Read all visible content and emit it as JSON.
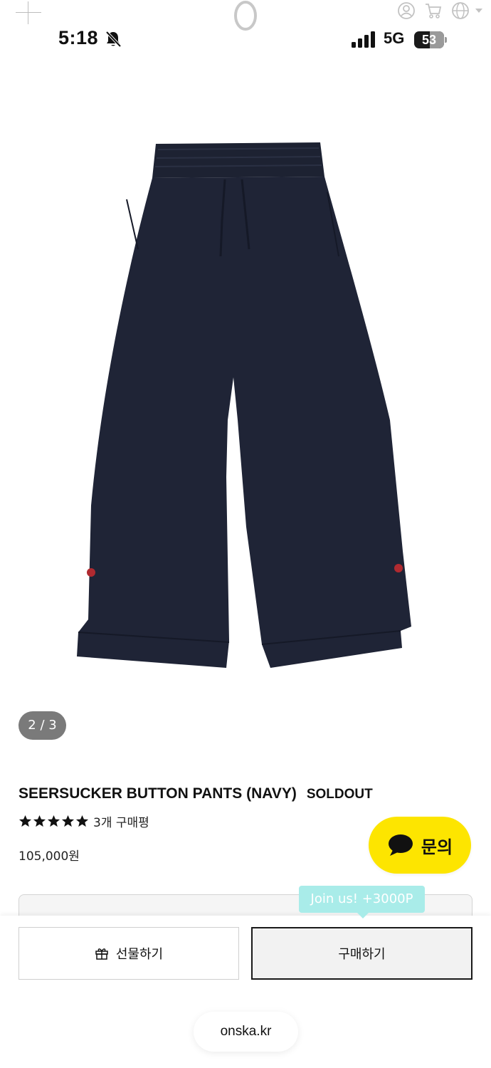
{
  "status_bar": {
    "time": "5:18",
    "network": "5G",
    "battery_level": "53",
    "battery_fraction": 0.53
  },
  "header": {
    "icons": [
      "plus-icon",
      "logo",
      "user-icon",
      "cart-icon",
      "globe-icon",
      "chevron-down-icon"
    ]
  },
  "gallery": {
    "indicator": "2 / 3"
  },
  "product": {
    "title": "SEERSUCKER BUTTON PANTS (NAVY)",
    "status": "SOLDOUT",
    "rating_stars": 5,
    "review_count": "3개 구매평",
    "price": "105,000원"
  },
  "chat": {
    "label": "문의",
    "color": "#fde500"
  },
  "promo": {
    "tooltip": "Join us! +3000P",
    "color": "#a9ece9"
  },
  "actions": {
    "gift_label": "선물하기",
    "buy_label": "구매하기"
  },
  "browser": {
    "url": "onska.kr"
  }
}
